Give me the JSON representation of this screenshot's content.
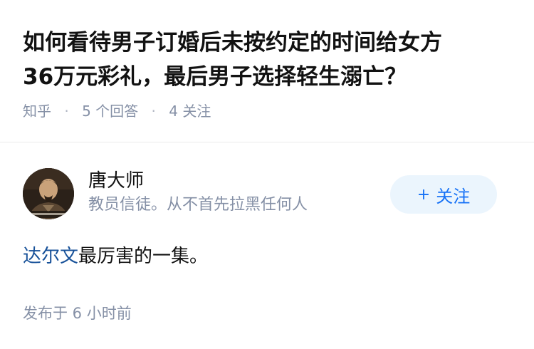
{
  "question": {
    "title_line1": "如何看待男子订婚后未按约定的时间给女方",
    "title_line2": "36万元彩礼，最后男子选择轻生溺亡？",
    "source": "知乎",
    "separator": "·",
    "answer_count": "5 个回答",
    "follow_count": "4 关注"
  },
  "answer": {
    "author": {
      "name": "唐大师",
      "bio": "教员信徒。从不首先拉黑任何人",
      "avatar_icon": "avatar-photo-icon"
    },
    "follow_button": {
      "plus": "+",
      "label": "关注"
    },
    "content": {
      "mention": "达尔文",
      "text": "最厉害的一集。"
    },
    "publish_time": "发布于 6 小时前"
  },
  "colors": {
    "title": "#121212",
    "meta": "#8590a6",
    "link": "#175199",
    "follow_bg": "#ebf5fd",
    "follow_text": "#1772f6",
    "divider": "#ebebeb"
  }
}
